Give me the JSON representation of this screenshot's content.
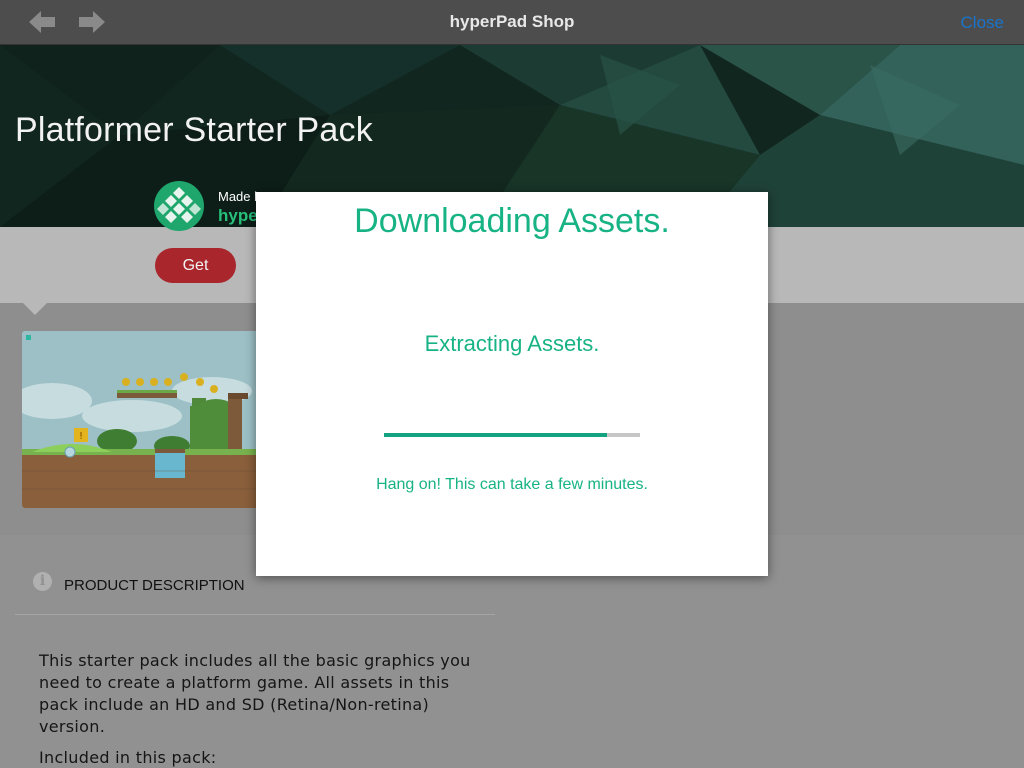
{
  "navbar": {
    "title": "hyperPad Shop",
    "close_label": "Close",
    "back_icon": "back-arrow-icon",
    "forward_icon": "forward-arrow-icon"
  },
  "product": {
    "title": "Platformer Starter Pack",
    "developer_prefix": "Made b",
    "developer_name": "hyper",
    "get_label": "Get"
  },
  "description": {
    "heading": "PRODUCT DESCRIPTION",
    "body": "This starter pack includes all the basic graphics you need to create a platform game. All assets in this pack include an HD and SD (Retina/Non-retina) version.",
    "included_label": "Included in this pack:"
  },
  "modal": {
    "title": "Downloading Assets.",
    "status": "Extracting Assets.",
    "progress": 0.87,
    "hint": "Hang on! This can take a few minutes."
  },
  "colors": {
    "accent": "#18b385",
    "link": "#1a74c9",
    "get_button": "#a8262c"
  }
}
